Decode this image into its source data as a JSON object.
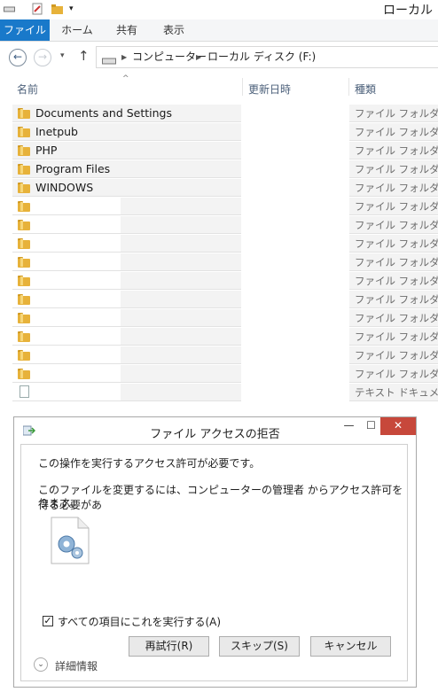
{
  "window": {
    "title": "ローカル"
  },
  "ribbon": {
    "tabs": [
      "ファイル",
      "ホーム",
      "共有",
      "表示"
    ]
  },
  "address": {
    "segments": [
      "コンピューター",
      "ローカル ディスク (F:)"
    ]
  },
  "columns": {
    "name": "名前",
    "date": "更新日時",
    "type": "種類"
  },
  "rows": [
    {
      "name": "Documents and Settings",
      "type": "ファイル フォルダー",
      "icon": "folder-icon"
    },
    {
      "name": "Inetpub",
      "type": "ファイル フォルダー",
      "icon": "folder-icon"
    },
    {
      "name": "PHP",
      "type": "ファイル フォルダー",
      "icon": "folder-icon"
    },
    {
      "name": "Program Files",
      "type": "ファイル フォルダー",
      "icon": "folder-icon"
    },
    {
      "name": "WINDOWS",
      "type": "ファイル フォルダー",
      "icon": "folder-icon"
    },
    {
      "name": "",
      "type": "ファイル フォルダー",
      "icon": "folder-icon"
    },
    {
      "name": "",
      "type": "ファイル フォルダー",
      "icon": "folder-icon"
    },
    {
      "name": "",
      "type": "ファイル フォルダー",
      "icon": "folder-icon"
    },
    {
      "name": "",
      "type": "ファイル フォルダー",
      "icon": "folder-icon"
    },
    {
      "name": "",
      "type": "ファイル フォルダー",
      "icon": "folder-icon"
    },
    {
      "name": "",
      "type": "ファイル フォルダー",
      "icon": "folder-icon"
    },
    {
      "name": "",
      "type": "ファイル フォルダー",
      "icon": "folder-icon"
    },
    {
      "name": "",
      "type": "ファイル フォルダー",
      "icon": "folder-icon"
    },
    {
      "name": "",
      "type": "ファイル フォルダー",
      "icon": "folder-icon"
    },
    {
      "name": "",
      "type": "ファイル フォルダー",
      "icon": "folder-icon"
    },
    {
      "name": "",
      "type": "テキスト ドキュメント",
      "icon": "text-file-icon"
    }
  ],
  "dialog": {
    "title": "ファイル アクセスの拒否",
    "message": "この操作を実行するアクセス許可が必要です。",
    "detail_line1": "このファイルを変更するには、コンピューターの管理者 からアクセス許可を得る必要があ",
    "detail_line2": "ります。",
    "checkbox_label": "すべての項目にこれを実行する(A)",
    "checkbox_checked": true,
    "buttons": {
      "retry": "再試行(R)",
      "skip": "スキップ(S)",
      "cancel": "キャンセル"
    },
    "details_label": "詳細情報"
  },
  "colors": {
    "file_tab": "#1979ca",
    "close_button": "#c7483b",
    "folder": "#e7b23a"
  }
}
